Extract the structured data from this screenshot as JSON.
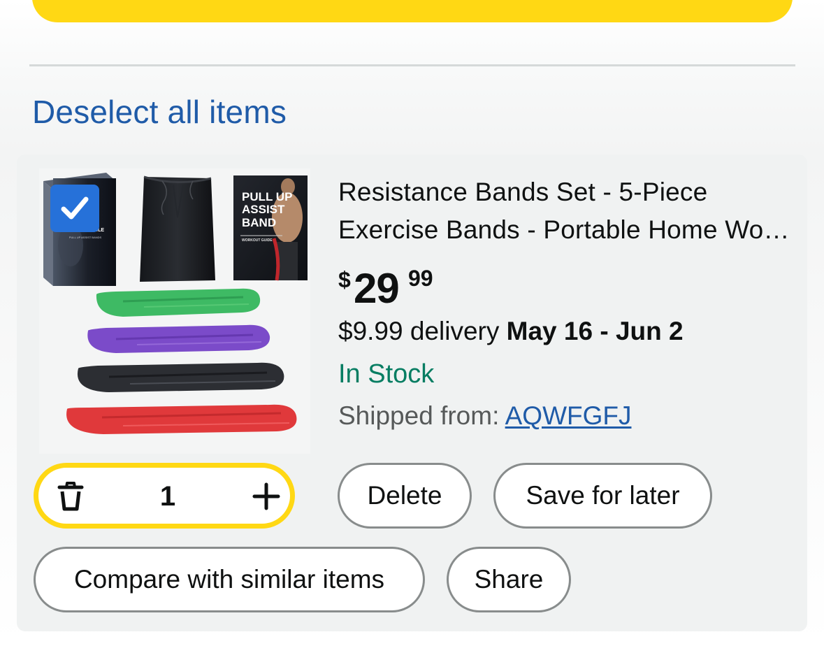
{
  "cart": {
    "deselect_label": "Deselect all items",
    "item": {
      "title_line1": "Resistance Bands Set - 5-Piece",
      "title_line2": "Exercise Bands - Portable Home Workout Equipment",
      "price": {
        "symbol": "$",
        "whole": "29",
        "fraction": "99"
      },
      "delivery_prefix": "$9.99 delivery",
      "delivery_date": "May 16 - Jun 2",
      "stock_status": "In Stock",
      "shipped_from_label": "Shipped from:",
      "seller_name": "AQWFGFJ",
      "selected": true,
      "quantity": "1",
      "image_text": {
        "box_title": "UNBREAKABLE",
        "box_subtitle": "PULL UP ASSIST BANDS",
        "guide_title_1": "PULL UP",
        "guide_title_2": "ASSIST",
        "guide_title_3": "BAND",
        "guide_subtitle": "WORKOUT GUIDE"
      }
    },
    "actions": {
      "delete_label": "Delete",
      "save_for_later_label": "Save for later",
      "compare_label": "Compare with similar items",
      "share_label": "Share"
    }
  },
  "colors": {
    "primary_yellow": "#ffd814",
    "link_blue": "#1f5ba8",
    "in_stock_green": "#067d62",
    "checkbox_blue": "#2671d9",
    "card_background": "#f0f2f2"
  },
  "icons": {
    "checkbox": "check-icon",
    "decrease": "trash-icon",
    "increase": "plus-icon"
  }
}
